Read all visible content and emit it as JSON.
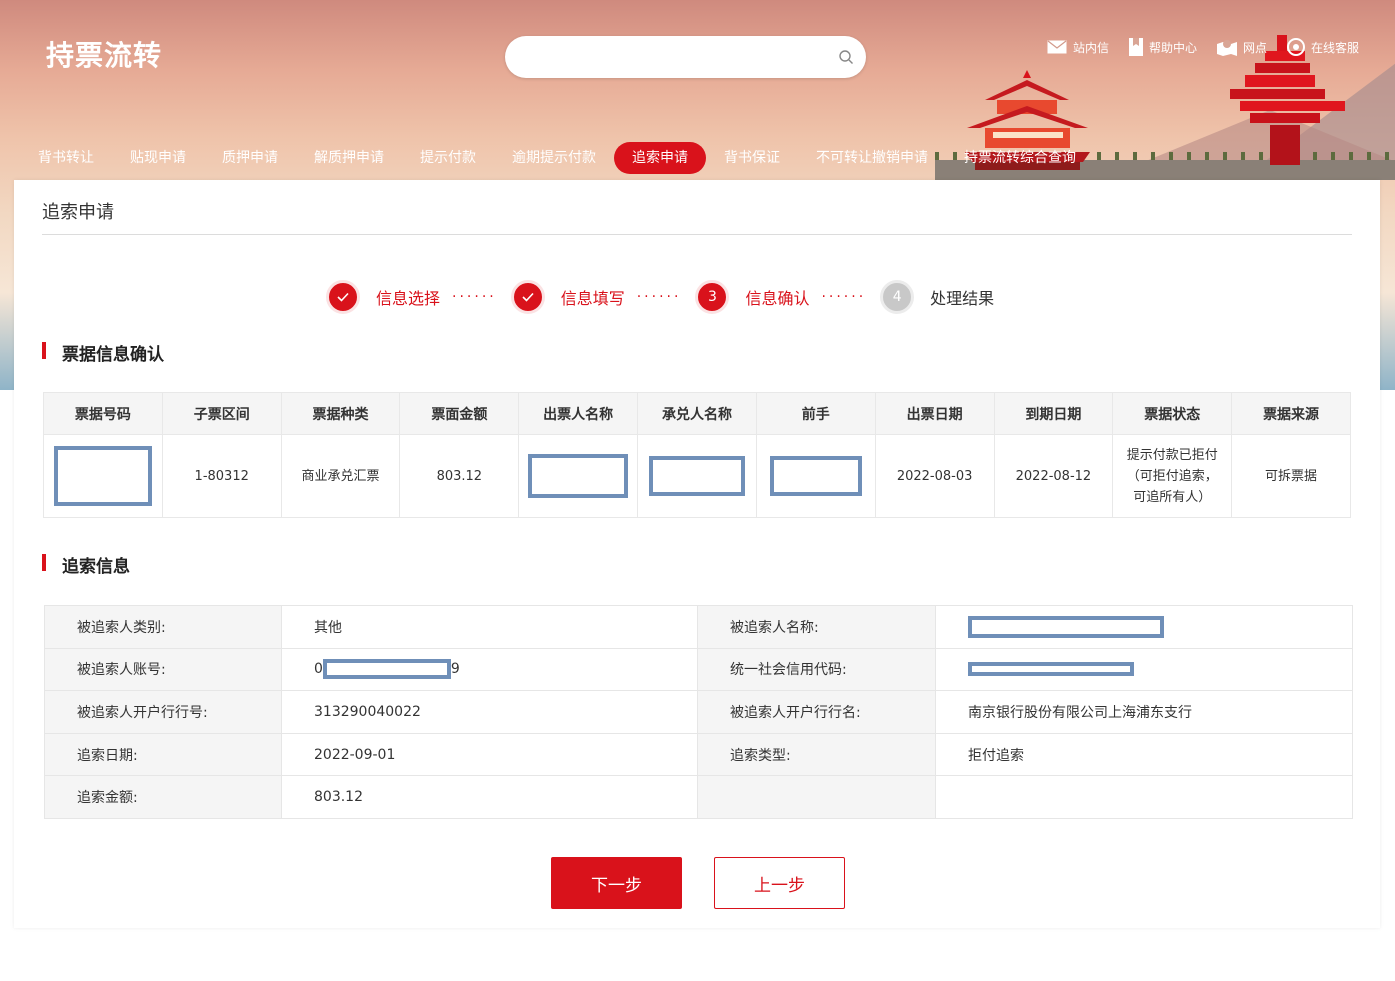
{
  "header": {
    "logo": "持票流转",
    "search_placeholder": "",
    "links": [
      {
        "label": "站内信",
        "icon": "mail-icon"
      },
      {
        "label": "帮助中心",
        "icon": "book-icon"
      },
      {
        "label": "网点",
        "icon": "map-pin-icon"
      },
      {
        "label": "在线客服",
        "icon": "headset-icon"
      }
    ]
  },
  "nav": {
    "items": [
      {
        "label": "背书转让"
      },
      {
        "label": "贴现申请"
      },
      {
        "label": "质押申请"
      },
      {
        "label": "解质押申请"
      },
      {
        "label": "提示付款"
      },
      {
        "label": "逾期提示付款"
      },
      {
        "label": "追索申请",
        "active": true
      },
      {
        "label": "背书保证"
      },
      {
        "label": "不可转让撤销申请"
      },
      {
        "label": "持票流转综合查询"
      }
    ]
  },
  "page": {
    "title": "追索申请"
  },
  "steps": [
    {
      "label": "信息选择",
      "state": "done",
      "number": ""
    },
    {
      "label": "信息填写",
      "state": "done",
      "number": ""
    },
    {
      "label": "信息确认",
      "state": "current",
      "number": "3"
    },
    {
      "label": "处理结果",
      "state": "todo",
      "number": "4"
    }
  ],
  "bill_section": {
    "title": "票据信息确认",
    "columns": [
      "票据号码",
      "子票区间",
      "票据种类",
      "票面金额",
      "出票人名称",
      "承兑人名称",
      "前手",
      "出票日期",
      "到期日期",
      "票据状态",
      "票据来源"
    ],
    "row": {
      "bill_no": "",
      "sub_range": "1-80312",
      "bill_type": "商业承兑汇票",
      "amount": "803.12",
      "drawer": "",
      "acceptor": "",
      "prior_holder": "",
      "issue_date": "2022-08-03",
      "due_date": "2022-08-12",
      "status": "提示付款已拒付（可拒付追索，可追所有人）",
      "source": "可拆票据"
    }
  },
  "recourse_section": {
    "title": "追索信息",
    "rows": [
      {
        "label1": "被追索人类别:",
        "value1": "其他",
        "label2": "被追索人名称:",
        "value2": ""
      },
      {
        "label1": "被追索人账号:",
        "value1_prefix": "0",
        "value1_suffix": "9",
        "label2": "统一社会信用代码:",
        "value2": ""
      },
      {
        "label1": "被追索人开户行行号:",
        "value1": "313290040022",
        "label2": "被追索人开户行行名:",
        "value2": "南京银行股份有限公司上海浦东支行"
      },
      {
        "label1": "追索日期:",
        "value1": "2022-09-01",
        "label2": "追索类型:",
        "value2": "拒付追索"
      },
      {
        "label1": "追索金额:",
        "value1": "803.12",
        "label2": "",
        "value2": ""
      }
    ]
  },
  "actions": {
    "next": "下一步",
    "prev": "上一步"
  },
  "colors": {
    "brand_red": "#d9121b",
    "redaction_border": "#6f8fb8"
  }
}
